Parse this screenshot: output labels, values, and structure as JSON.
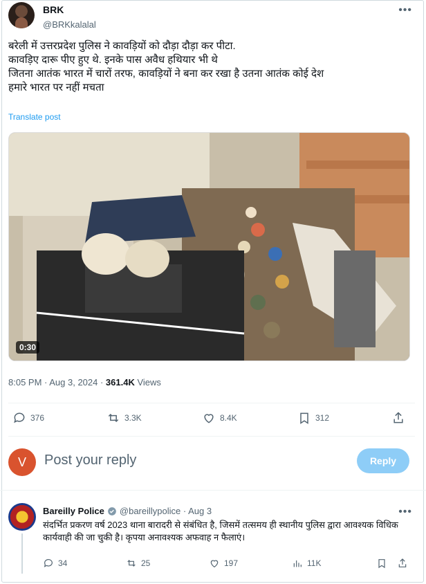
{
  "post": {
    "author_name": "BRK",
    "author_handle": "@BRKkalalal",
    "text_lines": [
      "बरेली में उत्तरप्रदेश पुलिस ने कावड़ियों को दौड़ा दौड़ा कर पीटा.",
      "कावड़िए दारू पीए हुए थे. इनके पास अवैध हथियार भी थे",
      " जितना आतंक  भारत में चारों तरफ, कावड़ियों ने बना कर रखा है उतना आतंक कोई देश",
      "हमारे भारत पर नहीं मचता"
    ],
    "translate_label": "Translate post",
    "video_duration": "0:30",
    "timestamp": "8:05 PM · Aug 3, 2024 · ",
    "views_count": "361.4K",
    "views_label": " Views",
    "stats": {
      "replies": "376",
      "reposts": "3.3K",
      "likes": "8.4K",
      "bookmarks": "312"
    }
  },
  "reply_box": {
    "avatar_letter": "V",
    "placeholder": "Post your reply",
    "button_label": "Reply"
  },
  "reply": {
    "author_name": "Bareilly Police",
    "author_handle": "@bareillypolice · Aug 3",
    "text": "संदर्भित प्रकरण वर्ष 2023 थाना बारादरी से संबंधित है, जिसमें तत्समय ही स्थानीय पुलिस द्वारा आवश्यक विधिक कार्यवाही की जा चुकी है। कृपया अनावश्यक अफवाह न फैलाएं।",
    "stats": {
      "replies": "34",
      "reposts": "25",
      "likes": "197",
      "views": "11K"
    }
  },
  "colors": {
    "accent": "#1d9bf0",
    "reply_button": "#8ecdf7",
    "muted_text": "#536471"
  }
}
